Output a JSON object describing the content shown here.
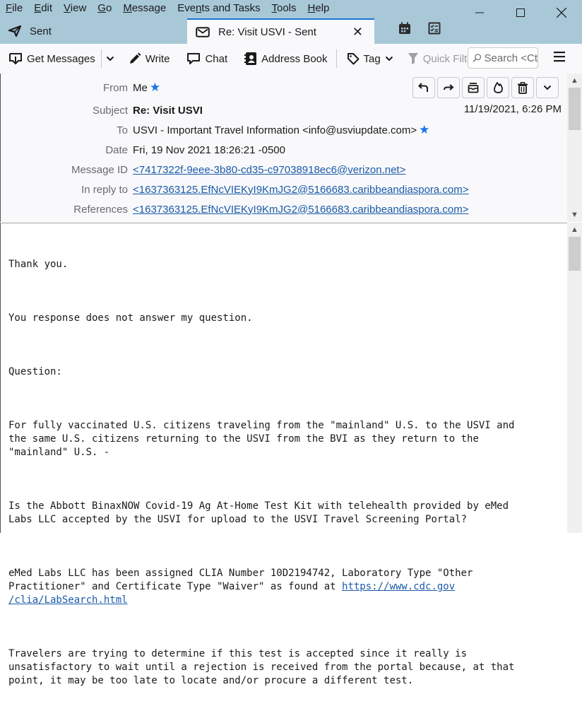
{
  "menubar": {
    "items": [
      {
        "label": "File",
        "accel": "F",
        "rest": "ile"
      },
      {
        "label": "Edit",
        "accel": "E",
        "rest": "dit"
      },
      {
        "label": "View",
        "accel": "V",
        "rest": "iew"
      },
      {
        "label": "Go",
        "accel": "G",
        "rest": "o"
      },
      {
        "label": "Message",
        "accel": "M",
        "rest": "essage"
      },
      {
        "label": "Events and Tasks",
        "pre": "Eve",
        "accel": "n",
        "rest": "ts and Tasks"
      },
      {
        "label": "Tools",
        "accel": "T",
        "rest": "ools"
      },
      {
        "label": "Help",
        "accel": "H",
        "rest": "elp"
      }
    ]
  },
  "tabs": [
    {
      "label": "Sent",
      "icon": "paper-plane-icon"
    },
    {
      "label": "Re: Visit USVI - Sent",
      "icon": "envelope-icon",
      "active": true
    }
  ],
  "toolbar": {
    "get_messages": "Get Messages",
    "write": "Write",
    "chat": "Chat",
    "address_book": "Address Book",
    "tag": "Tag",
    "quick_filter": "Quick Filter",
    "search_placeholder": "Search <Ct"
  },
  "header": {
    "from_label": "From",
    "from_value": "Me",
    "subject_label": "Subject",
    "subject_value": "Re: Visit USVI",
    "to_label": "To",
    "to_value": "USVI - Important Travel Information <info@usviupdate.com>",
    "date_label": "Date",
    "date_value": "Fri, 19 Nov 2021 18:26:21 -0500",
    "message_id_label": "Message ID",
    "message_id_value": "<7417322f-9eee-3b80-cd35-c97038918ec6@verizon.net>",
    "in_reply_to_label": "In reply to",
    "in_reply_to_value": "<1637363125.EfNcVIEKyI9KmJG2@5166683.caribbeandiaspora.com>",
    "references_label": "References",
    "references_value": "<1637363125.EfNcVIEKyI9KmJG2@5166683.caribbeandiaspora.com>",
    "received_date": "11/19/2021, 6:26 PM"
  },
  "body": {
    "p1": "Thank you.",
    "p2": "You response does not answer my question.",
    "p3": "Question:",
    "p4": "For fully vaccinated U.S. citizens traveling from the \"mainland\" U.S. to the USVI and\nthe same U.S. citizens returning to the USVI from the BVI as they return to the\n\"mainland\" U.S. -",
    "p5": "Is the Abbott BinaxNOW Covid-19 Ag At-Home Test Kit with telehealth provided by eMed\nLabs LLC accepted by the USVI for upload to the USVI Travel Screening Portal?",
    "p6_pre": "eMed Labs LLC has been assigned CLIA Number 10D2194742, Laboratory Type \"Other\nPractitioner\" and Certificate Type \"Waiver\" as found at ",
    "p6_link_a": "https://www.cdc.gov",
    "p6_link_b": "/clia/LabSearch.html",
    "p7": "Travelers are trying to determine if this test is accepted since it really is\nunsatisfactory to wait until a rejection is received from the portal because, at that\npoint, it may be too late to locate and/or procure a different test."
  }
}
